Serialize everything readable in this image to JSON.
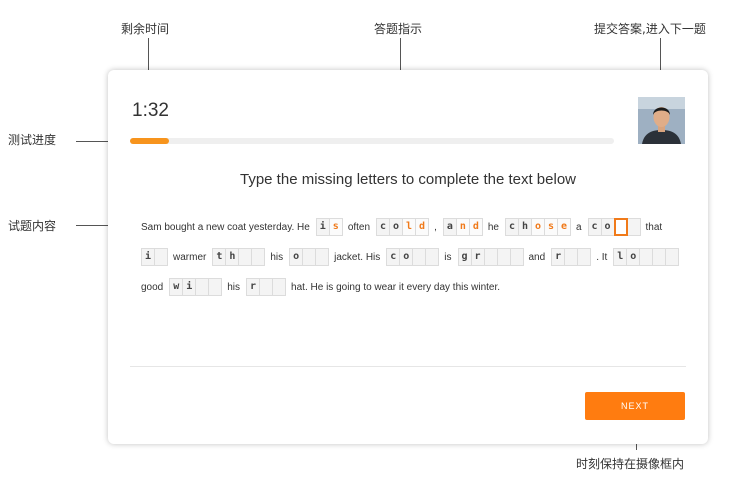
{
  "annotations": {
    "time_remaining": "剩余时间",
    "instructions": "答题指示",
    "submit_next": "提交答案,进入下一题",
    "progress": "测试进度",
    "content": "试题内容",
    "camera": "时刻保持在摄像框内"
  },
  "quiz": {
    "timer": "1:32",
    "progress_fraction": 0.08,
    "instruction": "Type the missing letters to complete the text below",
    "next_label": "NEXT"
  },
  "colors": {
    "accent": "#ff7c10",
    "typed_letter": "#f07a1a",
    "progress": "#f7941d"
  },
  "passage": {
    "lines": [
      [
        {
          "t": "text",
          "v": "Sam bought a new coat yesterday. He"
        },
        {
          "t": "word",
          "cells": [
            {
              "v": "i",
              "s": "given"
            },
            {
              "v": "s",
              "s": "typed"
            }
          ]
        },
        {
          "t": "text",
          "v": "often"
        },
        {
          "t": "word",
          "cells": [
            {
              "v": "c",
              "s": "given"
            },
            {
              "v": "o",
              "s": "given"
            },
            {
              "v": "l",
              "s": "typed"
            },
            {
              "v": "d",
              "s": "typed"
            }
          ]
        },
        {
          "t": "text",
          "v": ","
        },
        {
          "t": "word",
          "cells": [
            {
              "v": "a",
              "s": "given"
            },
            {
              "v": "n",
              "s": "typed"
            },
            {
              "v": "d",
              "s": "typed"
            }
          ]
        },
        {
          "t": "text",
          "v": "he"
        },
        {
          "t": "word",
          "cells": [
            {
              "v": "c",
              "s": "given"
            },
            {
              "v": "h",
              "s": "given"
            },
            {
              "v": "o",
              "s": "typed"
            },
            {
              "v": "s",
              "s": "typed"
            },
            {
              "v": "e",
              "s": "typed"
            }
          ]
        },
        {
          "t": "text",
          "v": "a"
        },
        {
          "t": "word",
          "cells": [
            {
              "v": "c",
              "s": "given"
            },
            {
              "v": "o",
              "s": "given"
            },
            {
              "v": "",
              "s": "active"
            },
            {
              "v": "",
              "s": "empty"
            }
          ]
        },
        {
          "t": "text",
          "v": "that"
        }
      ],
      [
        {
          "t": "word",
          "cells": [
            {
              "v": "i",
              "s": "given"
            },
            {
              "v": "",
              "s": "empty"
            }
          ]
        },
        {
          "t": "text",
          "v": "warmer"
        },
        {
          "t": "word",
          "cells": [
            {
              "v": "t",
              "s": "given"
            },
            {
              "v": "h",
              "s": "given"
            },
            {
              "v": "",
              "s": "empty"
            },
            {
              "v": "",
              "s": "empty"
            }
          ]
        },
        {
          "t": "text",
          "v": "his"
        },
        {
          "t": "word",
          "cells": [
            {
              "v": "o",
              "s": "given"
            },
            {
              "v": "",
              "s": "empty"
            },
            {
              "v": "",
              "s": "empty"
            }
          ]
        },
        {
          "t": "text",
          "v": "jacket.  His"
        },
        {
          "t": "word",
          "cells": [
            {
              "v": "c",
              "s": "given"
            },
            {
              "v": "o",
              "s": "given"
            },
            {
              "v": "",
              "s": "empty"
            },
            {
              "v": "",
              "s": "empty"
            }
          ]
        },
        {
          "t": "text",
          "v": "is"
        },
        {
          "t": "word",
          "cells": [
            {
              "v": "g",
              "s": "given"
            },
            {
              "v": "r",
              "s": "given"
            },
            {
              "v": "",
              "s": "empty"
            },
            {
              "v": "",
              "s": "empty"
            },
            {
              "v": "",
              "s": "empty"
            }
          ]
        },
        {
          "t": "text",
          "v": "and"
        },
        {
          "t": "word",
          "cells": [
            {
              "v": "r",
              "s": "given"
            },
            {
              "v": "",
              "s": "empty"
            },
            {
              "v": "",
              "s": "empty"
            }
          ]
        },
        {
          "t": "text",
          "v": ". It"
        },
        {
          "t": "word",
          "cells": [
            {
              "v": "l",
              "s": "given"
            },
            {
              "v": "o",
              "s": "given"
            },
            {
              "v": "",
              "s": "empty"
            },
            {
              "v": "",
              "s": "empty"
            },
            {
              "v": "",
              "s": "empty"
            }
          ]
        }
      ],
      [
        {
          "t": "text",
          "v": "good"
        },
        {
          "t": "word",
          "cells": [
            {
              "v": "w",
              "s": "given"
            },
            {
              "v": "i",
              "s": "given"
            },
            {
              "v": "",
              "s": "empty"
            },
            {
              "v": "",
              "s": "empty"
            }
          ]
        },
        {
          "t": "text",
          "v": "his"
        },
        {
          "t": "word",
          "cells": [
            {
              "v": "r",
              "s": "given"
            },
            {
              "v": "",
              "s": "empty"
            },
            {
              "v": "",
              "s": "empty"
            }
          ]
        },
        {
          "t": "text",
          "v": "hat. He is going to wear it every day this winter."
        }
      ]
    ]
  }
}
